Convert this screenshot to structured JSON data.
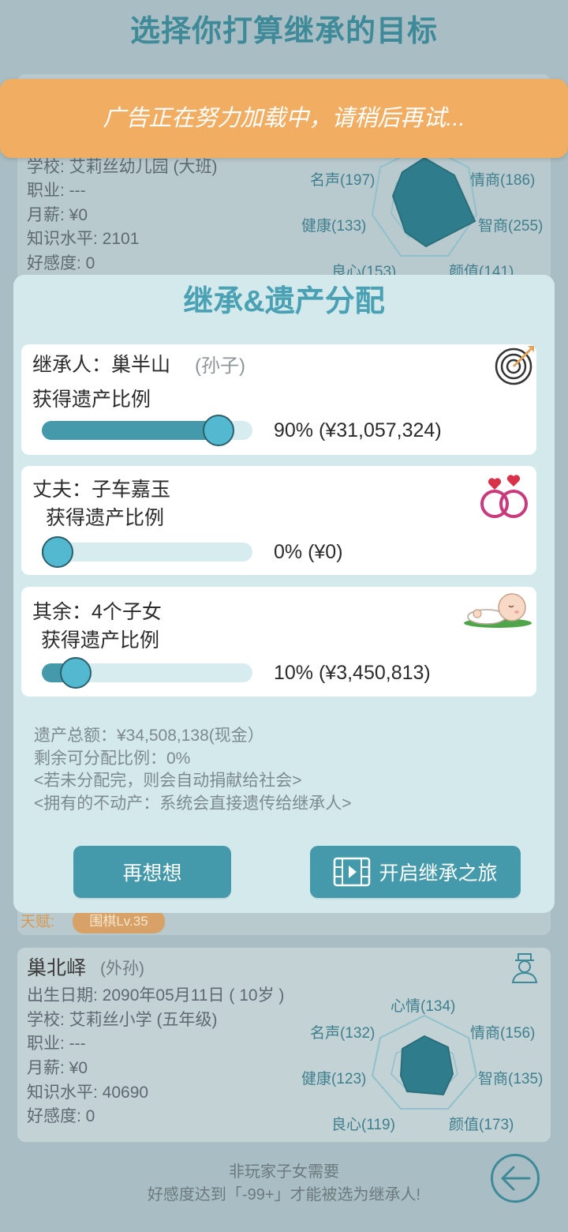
{
  "page": {
    "title": "选择你打算继承的目标",
    "ad_message": "广告正在努力加载中，请稍后再试...",
    "footer_line1": "非玩家子女需要",
    "footer_line2": "好感度达到「-99+」才能被选为继承人!"
  },
  "bg_card_1": {
    "school": "学校: 艾莉丝幼儿园 (大班)",
    "job": "职业: ---",
    "salary": "月薪: ¥0",
    "knowledge": "知识水平: 2101",
    "affection": "好感度: 0",
    "radar": {
      "fame": "名声(197)",
      "eq": "情商(186)",
      "health": "健康(133)",
      "iq": "智商(255)",
      "conscience": "良心(153)",
      "looks": "颜值(141)"
    },
    "talent_label": "天赋:",
    "talent_value": "围棋Lv.35"
  },
  "bg_card_2": {
    "name": "巢北峄",
    "relation": "(外孙)",
    "birth": "出生日期: 2090年05月11日 ( 10岁 )",
    "school": "学校: 艾莉丝小学 (五年级)",
    "job": "职业: ---",
    "salary": "月薪: ¥0",
    "knowledge": "知识水平: 40690",
    "affection": "好感度: 0",
    "radar": {
      "mood": "心情(134)",
      "fame": "名声(132)",
      "eq": "情商(156)",
      "health": "健康(123)",
      "iq": "智商(135)",
      "conscience": "良心(119)",
      "looks": "颜值(173)"
    }
  },
  "modal": {
    "title": "继承&遗产分配",
    "heirs": [
      {
        "label": "继承人：巢半山",
        "sub": "(孙子)",
        "ratio_label": "获得遗产比例",
        "percent": 90,
        "value_text": "90% (¥31,057,324)",
        "icon": "target-icon"
      },
      {
        "label": "丈夫：子车嘉玉",
        "sub": "",
        "ratio_label": "获得遗产比例",
        "percent": 0,
        "value_text": "0% (¥0)",
        "icon": "wedding-rings-icon"
      },
      {
        "label": "其余：4个子女",
        "sub": "",
        "ratio_label": "获得遗产比例",
        "percent": 10,
        "value_text": "10% (¥3,450,813)",
        "icon": "sleeping-baby-icon"
      }
    ],
    "summary": {
      "total": "遗产总额：¥34,508,138(现金）",
      "remaining": "剩余可分配比例：0%",
      "note1": "<若未分配完，则会自动捐献给社会>",
      "note2": "<拥有的不动产：系统会直接遗传给继承人>"
    },
    "buttons": {
      "reconsider": "再想想",
      "start": "开启继承之旅"
    }
  },
  "colors": {
    "accent": "#4499ab",
    "title": "#3f8a99",
    "ad": "#f1ae62",
    "modal_bg": "#d3e9ec"
  }
}
